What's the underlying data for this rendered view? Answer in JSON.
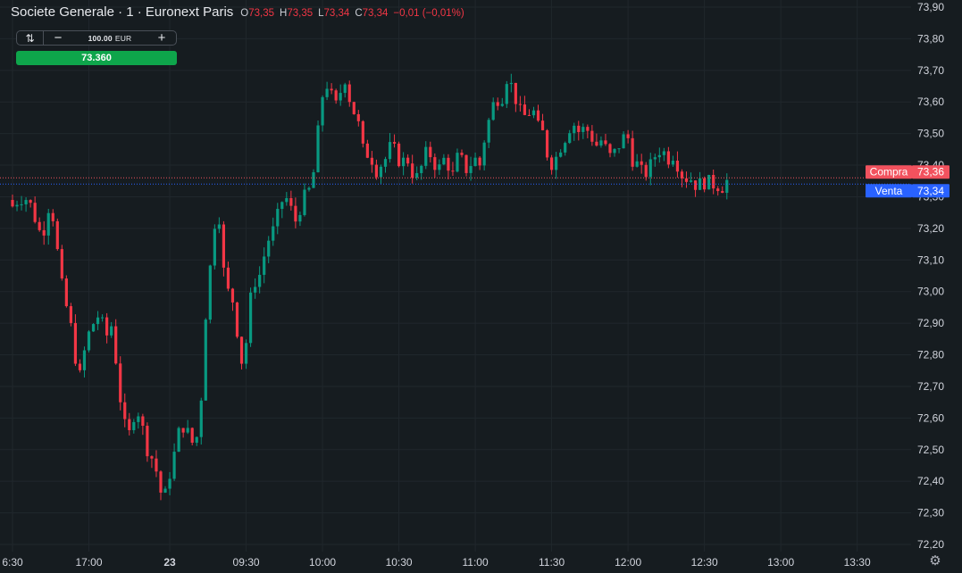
{
  "header": {
    "title": "Societe Generale · 1 · Euronext Paris",
    "ohlc": [
      {
        "label": "O",
        "value": "73,35"
      },
      {
        "label": "H",
        "value": "73,35"
      },
      {
        "label": "L",
        "value": "73,34"
      },
      {
        "label": "C",
        "value": "73,34"
      }
    ],
    "change": "−0,01 (−0,01%)"
  },
  "ticket": {
    "swap_glyph": "⇅",
    "minus": "−",
    "quantity": "100.00",
    "unit": "EUR",
    "plus": "+",
    "price_button": "73.360"
  },
  "price_tags": {
    "buy": {
      "label": "Compra",
      "value": "73,36",
      "color": "#f2525e"
    },
    "sell": {
      "label": "Venta",
      "value": "73,34",
      "color": "#2962ff"
    }
  },
  "colors": {
    "background": "#161c20",
    "grid": "#20272c",
    "up": "#089981",
    "down": "#f23645",
    "axis_text": "#d1d4dc",
    "ask_line": "#f2525e",
    "bid_line": "#2962ff"
  },
  "settings_icon": "gear-icon",
  "chart_data": {
    "type": "candlestick",
    "ylim": [
      72.17,
      73.93
    ],
    "yticks": [
      "73,90",
      "73,80",
      "73,70",
      "73,60",
      "73,50",
      "73,40",
      "73,30",
      "73,20",
      "73,10",
      "73,00",
      "72,90",
      "72,80",
      "72,70",
      "72,60",
      "72,50",
      "72,40",
      "72,30",
      "72,20"
    ],
    "ytick_values": [
      73.9,
      73.8,
      73.7,
      73.6,
      73.5,
      73.4,
      73.3,
      73.2,
      73.1,
      73.0,
      72.9,
      72.8,
      72.7,
      72.6,
      72.5,
      72.4,
      72.3,
      72.2
    ],
    "xticks": [
      {
        "label": "6:30",
        "i": 0
      },
      {
        "label": "17:00",
        "i": 17
      },
      {
        "label": "23",
        "i": 35
      },
      {
        "label": "09:30",
        "i": 52
      },
      {
        "label": "10:00",
        "i": 69
      },
      {
        "label": "10:30",
        "i": 86
      },
      {
        "label": "11:00",
        "i": 103
      },
      {
        "label": "11:30",
        "i": 120
      },
      {
        "label": "12:00",
        "i": 137
      },
      {
        "label": "12:30",
        "i": 154
      },
      {
        "label": "13:00",
        "i": 171
      },
      {
        "label": "13:30",
        "i": 188
      }
    ],
    "bars": 200,
    "ask": 73.36,
    "bid": 73.34,
    "series": [
      {
        "close": [
          73.27,
          73.29,
          73.3,
          73.29,
          73.25,
          73.19,
          73.2,
          73.28,
          73.22,
          73.05,
          72.97,
          72.9,
          72.79,
          72.72,
          72.85,
          72.88,
          72.93,
          72.9,
          72.86,
          72.9,
          72.73,
          72.6,
          72.53,
          72.61,
          72.62,
          72.55,
          72.48,
          72.47,
          72.37,
          72.35,
          72.43,
          72.5,
          72.58,
          72.57,
          72.52,
          72.53,
          72.68,
          73.0,
          73.12,
          73.32,
          73.08,
          73.0,
          72.97,
          72.85,
          72.74,
          72.95,
          73.03,
          73.05,
          73.12,
          73.18,
          73.2,
          73.28,
          73.3,
          73.26,
          73.22,
          73.28,
          73.31,
          73.33,
          73.48,
          73.62,
          73.66,
          73.6,
          73.58,
          73.7,
          73.62,
          73.57,
          73.52,
          73.42,
          73.45,
          73.38,
          73.4,
          73.42,
          73.46,
          73.44,
          73.4,
          73.43,
          73.38,
          73.36,
          73.4,
          73.45,
          73.42,
          73.38,
          73.42,
          73.4,
          73.36,
          73.45,
          73.38,
          73.4,
          73.42,
          73.4,
          73.5,
          73.56,
          73.62,
          73.6,
          73.68,
          73.65,
          73.6,
          73.55,
          73.56,
          73.58,
          73.52,
          73.5,
          73.42,
          73.4,
          73.45,
          73.48,
          73.52,
          73.53,
          73.5,
          73.52,
          73.5,
          73.46,
          73.48,
          73.45,
          73.42,
          73.45,
          73.48,
          73.5,
          73.42,
          73.4,
          73.37,
          73.38,
          73.42,
          73.45,
          73.44,
          73.42,
          73.44,
          73.38,
          73.36,
          73.36,
          73.34,
          73.34,
          73.35,
          73.34,
          73.34,
          73.33,
          73.35
        ],
        "name": ""
      }
    ]
  }
}
